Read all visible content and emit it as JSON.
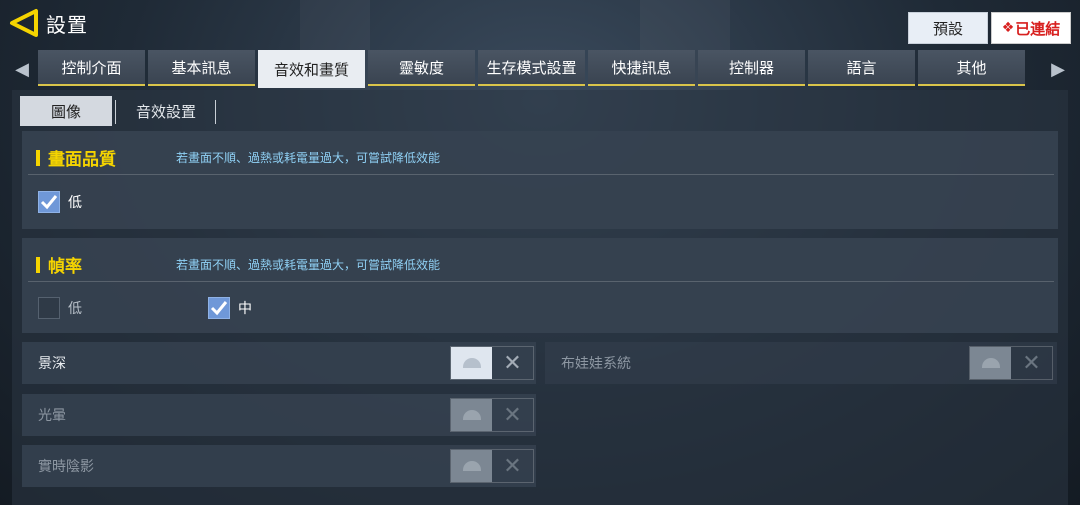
{
  "header": {
    "title": "設置",
    "preset_label": "預設",
    "linked_label": "已連結",
    "linked_icon": "garena-icon"
  },
  "tabs": [
    {
      "label": "控制介面",
      "active": false
    },
    {
      "label": "基本訊息",
      "active": false
    },
    {
      "label": "音效和畫質",
      "active": true
    },
    {
      "label": "靈敏度",
      "active": false
    },
    {
      "label": "生存模式設置",
      "active": false
    },
    {
      "label": "快捷訊息",
      "active": false
    },
    {
      "label": "控制器",
      "active": false
    },
    {
      "label": "語言",
      "active": false
    },
    {
      "label": "其他",
      "active": false
    }
  ],
  "subtabs": {
    "image": "圖像",
    "sound": "音效設置"
  },
  "quality": {
    "title": "畫面品質",
    "hint": "若畫面不順、過熱或耗電量過大，可嘗試降低效能",
    "options": [
      {
        "label": "低",
        "checked": true
      }
    ]
  },
  "framerate": {
    "title": "幀率",
    "hint": "若畫面不順、過熱或耗電量過大，可嘗試降低效能",
    "options": [
      {
        "label": "低",
        "checked": false
      },
      {
        "label": "中",
        "checked": true
      }
    ]
  },
  "toggles": {
    "depth_of_field": "景深",
    "ragdoll": "布娃娃系統",
    "bloom": "光暈",
    "realtime_shadow": "實時陰影"
  },
  "colors": {
    "accent_yellow": "#f5d400",
    "hint_blue": "#8fd0f4",
    "check_blue": "#6f98d8",
    "linked_red": "#d8201f"
  }
}
